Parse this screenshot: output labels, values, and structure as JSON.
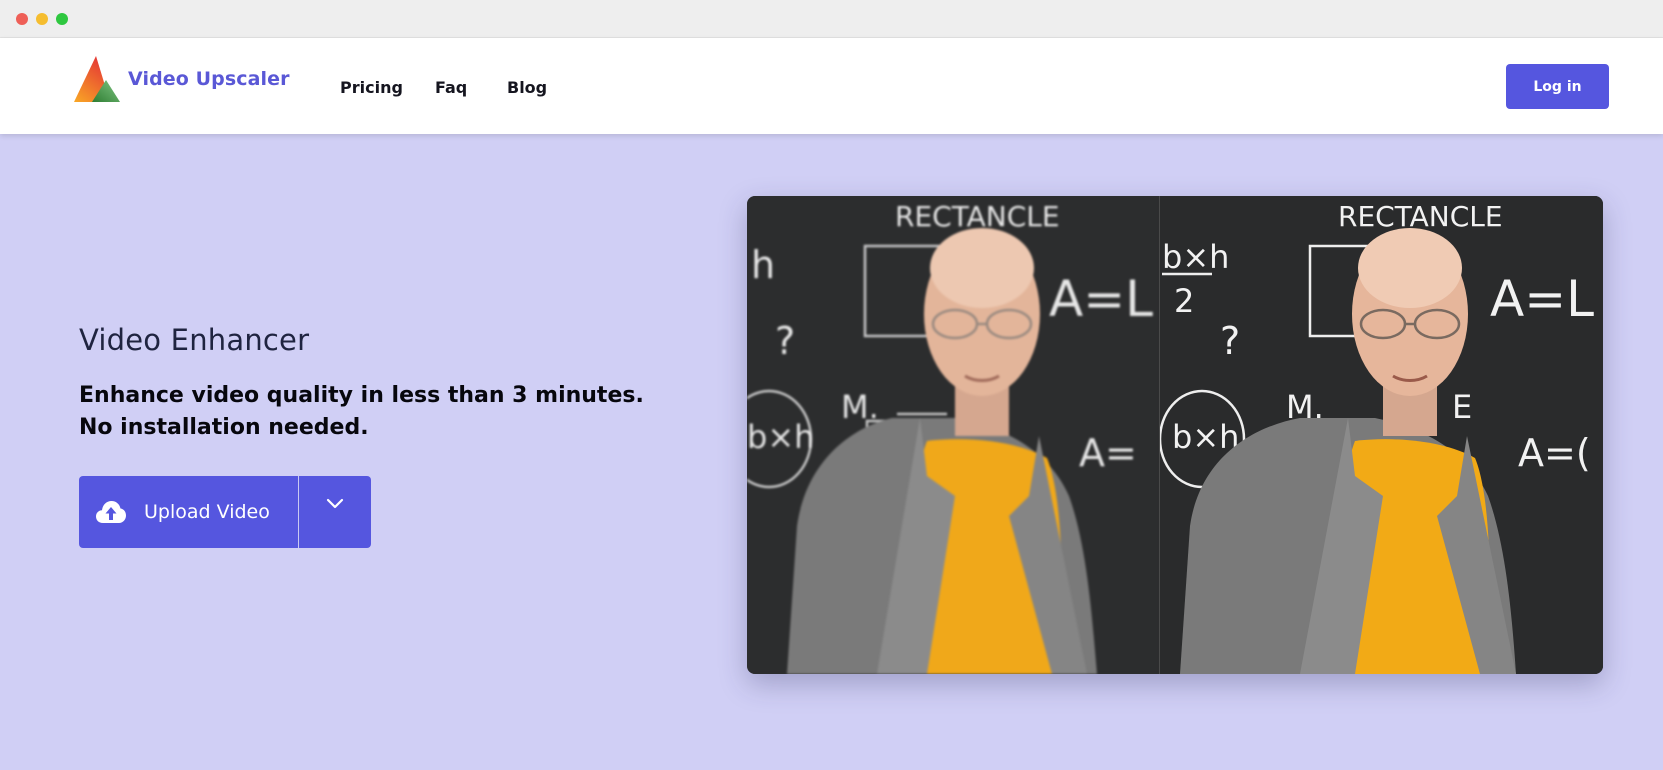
{
  "window": {
    "controls": [
      "close",
      "minimize",
      "maximize"
    ]
  },
  "header": {
    "logo_text": "Video Upscaler",
    "logo_icon": "triangle-logo-icon",
    "nav": [
      {
        "label": "Pricing"
      },
      {
        "label": "Faq"
      },
      {
        "label": "Blog"
      }
    ],
    "login_label": "Log in"
  },
  "hero": {
    "title": "Video Enhancer",
    "subtitle": "Enhance video quality in less than 3 minutes. No installation needed.",
    "upload_label": "Upload Video",
    "upload_icon": "cloud-upload-icon",
    "dropdown_icon": "chevron-down-icon"
  },
  "comparison": {
    "left_board_texts": [
      "RECTANCLE",
      "h",
      "?",
      "A=L",
      "M.",
      "b×h",
      "A="
    ],
    "right_board_texts": [
      "RECTANCLE",
      "b×h",
      "2",
      "?",
      "A=L",
      "M.",
      "E",
      "b×h",
      "A=("
    ]
  },
  "colors": {
    "accent": "#5556df",
    "background": "#d0cff5",
    "logo_text": "#5a58d6",
    "shirt": "#f0a81a",
    "blazer": "#7a7a7a"
  }
}
